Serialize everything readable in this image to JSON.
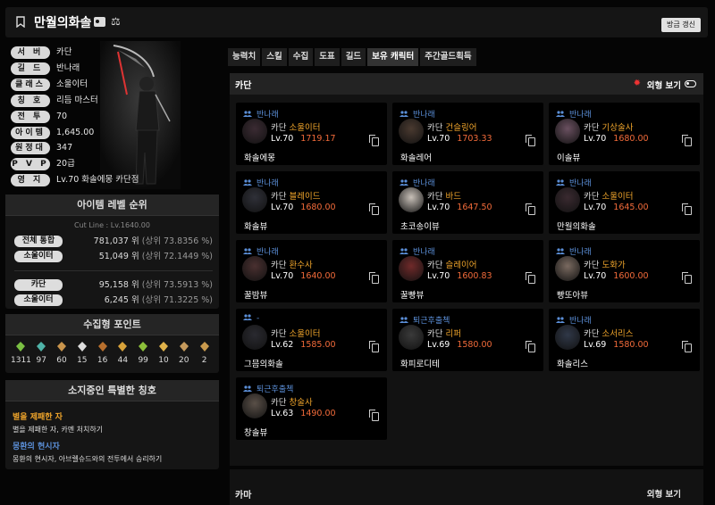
{
  "header": {
    "name": "만월의화솔",
    "renew_label": "방금 갱신"
  },
  "profile": {
    "stats": [
      {
        "key": "서 버",
        "value": "카단"
      },
      {
        "key": "길 드",
        "value": "반나래"
      },
      {
        "key": "클래스",
        "value": "소울이터"
      },
      {
        "key": "칭 호",
        "value": "리듬 마스터"
      },
      {
        "key": "전 투",
        "value": "70"
      },
      {
        "key": "아이템",
        "value": "1,645.00"
      },
      {
        "key": "원정대",
        "value": "347"
      },
      {
        "key": "P V P",
        "value": "20급"
      },
      {
        "key": "영 지",
        "value": "Lv.70 화솔에몽 카단점"
      }
    ]
  },
  "item_rank": {
    "title": "아이템 레벨 순위",
    "cutline": "Cut Line : Lv.1640.00",
    "rows": [
      {
        "key": "전체 통합",
        "rank": "781,037 위",
        "pct": "(상위 73.8356 %)"
      },
      {
        "key": "소울이터",
        "rank": "51,049 위",
        "pct": "(상위 72.1449 %)"
      },
      {
        "key": "카단",
        "rank": "95,158 위",
        "pct": "(상위 73.5913 %)"
      },
      {
        "key": "소울이터",
        "rank": "6,245 위",
        "pct": "(상위 71.3225 %)"
      }
    ]
  },
  "collect": {
    "title": "수집형 포인트",
    "points": [
      {
        "icon": "mokoko-seed-icon",
        "value": "1311",
        "color": "#7bc043"
      },
      {
        "icon": "island-heart-icon",
        "value": "97",
        "color": "#4fb3a8"
      },
      {
        "icon": "giant-heart-icon",
        "value": "60",
        "color": "#c9954c"
      },
      {
        "icon": "ignea-token-icon",
        "value": "15",
        "color": "#ddd"
      },
      {
        "icon": "art-icon",
        "value": "16",
        "color": "#b86f2d"
      },
      {
        "icon": "voyage-icon",
        "value": "44",
        "color": "#d8a23a"
      },
      {
        "icon": "world-tree-leaf-icon",
        "value": "99",
        "color": "#8cbf3a"
      },
      {
        "icon": "orpheus-star-icon",
        "value": "10",
        "color": "#e0b24a"
      },
      {
        "icon": "orb-icon",
        "value": "20",
        "color": "#c59a5c"
      },
      {
        "icon": "map-icon",
        "value": "2",
        "color": "#c99a4d"
      }
    ]
  },
  "special_titles": {
    "title": "소지중인 특별한 칭호",
    "items": [
      {
        "name": "별을 제패한 자",
        "desc": "별을 제패한 자, 카멘 처치하기",
        "color": "#f0a52b"
      },
      {
        "name": "몽환의 현시자",
        "desc": "몽환의 현시자, 아브렐슈드와의 전투에서 승리하기",
        "color": "#5b8fd8"
      }
    ]
  },
  "tabs": [
    "능력치",
    "스킬",
    "수집",
    "도표",
    "길드",
    "보유 캐릭터",
    "주간골드획득"
  ],
  "active_tab": "보유 캐릭터",
  "server_section": {
    "name": "카단",
    "view_label": "외형 보기"
  },
  "characters": [
    {
      "guild": "반나래",
      "server": "카단",
      "class": "소울이터",
      "level": "Lv.70",
      "ilvl": "1719.17",
      "name": "화솔에몽"
    },
    {
      "guild": "반나래",
      "server": "카단",
      "class": "건슬링어",
      "level": "Lv.70",
      "ilvl": "1703.33",
      "name": "화솔레어"
    },
    {
      "guild": "반나래",
      "server": "카단",
      "class": "기상술사",
      "level": "Lv.70",
      "ilvl": "1680.00",
      "name": "이솔뷰"
    },
    {
      "guild": "반나래",
      "server": "카단",
      "class": "블레이드",
      "level": "Lv.70",
      "ilvl": "1680.00",
      "name": "화솔뷰"
    },
    {
      "guild": "반나래",
      "server": "카단",
      "class": "바드",
      "level": "Lv.70",
      "ilvl": "1647.50",
      "name": "초코송이뷰"
    },
    {
      "guild": "반나래",
      "server": "카단",
      "class": "소울이터",
      "level": "Lv.70",
      "ilvl": "1645.00",
      "name": "만월의화솔"
    },
    {
      "guild": "반나래",
      "server": "카단",
      "class": "환수사",
      "level": "Lv.70",
      "ilvl": "1640.00",
      "name": "꿀밤뷰"
    },
    {
      "guild": "반나래",
      "server": "카단",
      "class": "슬레이어",
      "level": "Lv.70",
      "ilvl": "1600.83",
      "name": "꿀빵뷰"
    },
    {
      "guild": "반나래",
      "server": "카단",
      "class": "도화가",
      "level": "Lv.70",
      "ilvl": "1600.00",
      "name": "빵또아뷰"
    },
    {
      "guild": "-",
      "server": "카단",
      "class": "소울이터",
      "level": "Lv.62",
      "ilvl": "1585.00",
      "name": "그믐의화솔"
    },
    {
      "guild": "퇴근후출첵",
      "server": "카단",
      "class": "리퍼",
      "level": "Lv.69",
      "ilvl": "1580.00",
      "name": "화피로디테"
    },
    {
      "guild": "반나래",
      "server": "카단",
      "class": "소서리스",
      "level": "Lv.69",
      "ilvl": "1580.00",
      "name": "화솔리스"
    },
    {
      "guild": "퇴근후출첵",
      "server": "카단",
      "class": "창술사",
      "level": "Lv.63",
      "ilvl": "1490.00",
      "name": "창솔뷰"
    }
  ],
  "next_section": {
    "name": "카마",
    "view_label": "외형 보기"
  }
}
